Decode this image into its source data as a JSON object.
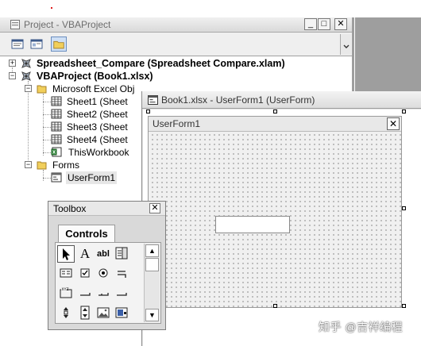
{
  "project_window": {
    "title": "Project - VBAProject",
    "buttons": {
      "minimize": "_",
      "restore": "□",
      "close": "✕"
    }
  },
  "tree": {
    "nodes": [
      {
        "label": "Spreadsheet_Compare (Spreadsheet Compare.xlam)",
        "expander": "+"
      },
      {
        "label": "VBAProject (Book1.xlsx)",
        "expander": "−"
      },
      {
        "label": "Microsoft Excel Obj",
        "expander": "−"
      },
      {
        "label": "Sheet1 (Sheet"
      },
      {
        "label": "Sheet2 (Sheet"
      },
      {
        "label": "Sheet3 (Sheet"
      },
      {
        "label": "Sheet4 (Sheet"
      },
      {
        "label": "ThisWorkbook"
      },
      {
        "label": "Forms",
        "expander": "−"
      },
      {
        "label": "UserForm1"
      }
    ]
  },
  "designer_window": {
    "title": "Book1.xlsx - UserForm1 (UserForm)"
  },
  "userform": {
    "caption": "UserForm1",
    "close": "✕"
  },
  "toolbox": {
    "title": "Toolbox",
    "close": "✕",
    "tab": "Controls",
    "tools": {
      "label": "A",
      "textbox": "abl"
    },
    "scroll_up": "▲",
    "scroll_down": "▼"
  },
  "watermark": "知乎 @吉祥编程",
  "colors": {
    "titlebar_text": "#6d6d6d",
    "window_border": "#8d8d8d",
    "grid_dot": "#4a4a4a"
  }
}
